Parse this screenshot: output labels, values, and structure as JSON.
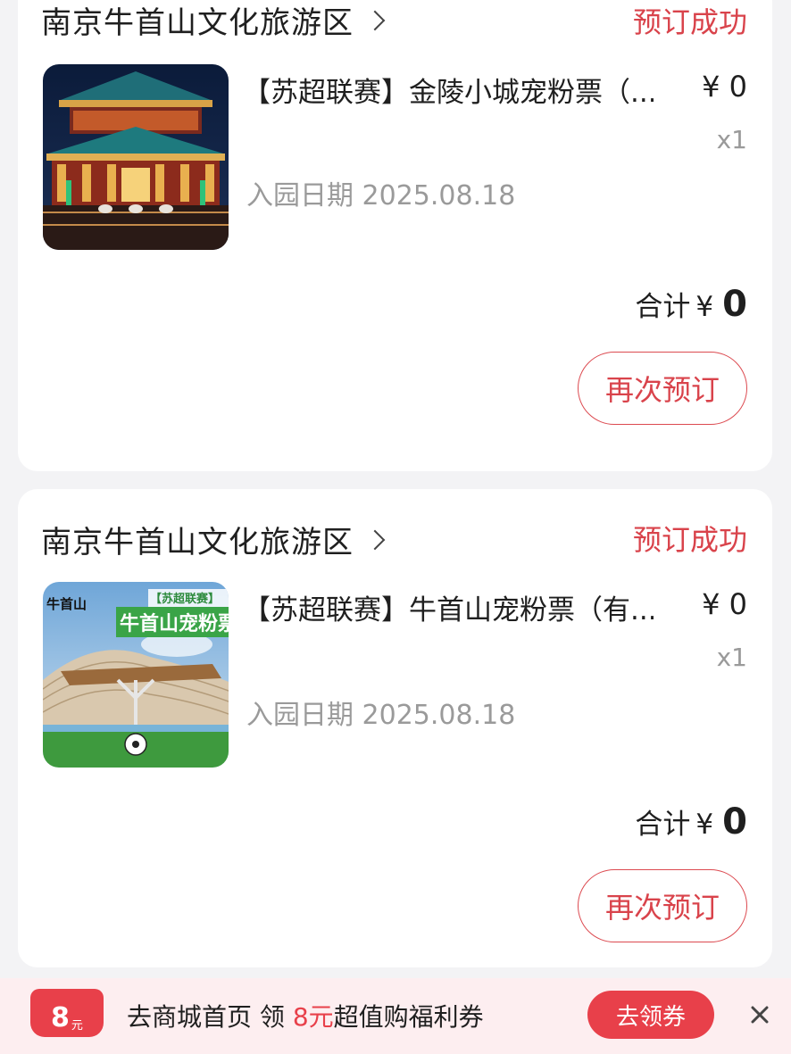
{
  "orders": [
    {
      "shop": "南京牛首山文化旅游区",
      "status": "预订成功",
      "title": "【苏超联赛】金陵小城宠粉票（...",
      "price": "¥ 0",
      "qty": "x1",
      "date": "入园日期 2025.08.18",
      "total_label": "合计",
      "total_currency": "¥",
      "total_amount": "0",
      "rebook": "再次预订"
    },
    {
      "shop": "南京牛首山文化旅游区",
      "status": "预订成功",
      "title": "【苏超联赛】牛首山宠粉票（有...",
      "price": "¥ 0",
      "qty": "x1",
      "date": "入园日期 2025.08.18",
      "total_label": "合计",
      "total_currency": "¥",
      "total_amount": "0",
      "rebook": "再次预订",
      "thumb_text": {
        "logo": "牛首山",
        "tag": "【苏超联赛】",
        "banner": "牛首山宠粉票"
      }
    }
  ],
  "promo": {
    "coupon_value": "8",
    "coupon_unit": "元",
    "text_before": "去商城首页 领",
    "text_highlight": "8元",
    "text_after": "超值购福利券",
    "claim_button": "去领券"
  },
  "colors": {
    "accent": "#e8404a",
    "status": "#d9434b",
    "muted": "#9a9a9a"
  }
}
